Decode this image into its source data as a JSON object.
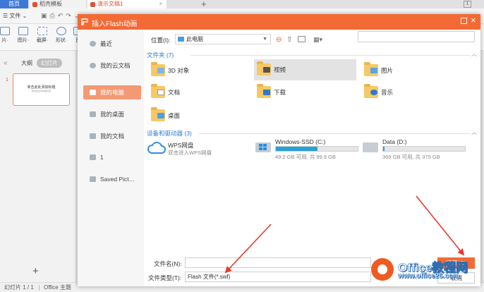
{
  "app": {
    "tabs": [
      {
        "label": "首页"
      },
      {
        "label": "稻壳模板"
      },
      {
        "label": "演示文稿1"
      }
    ],
    "menu_file": "文件",
    "toolbar": [
      {
        "label": "片·"
      },
      {
        "label": "图片·"
      },
      {
        "label": "截屏·"
      },
      {
        "label": "形状·"
      },
      {
        "label": "图"
      }
    ],
    "left_panel": {
      "tab_outline": "大纲",
      "tab_slides": "幻灯片",
      "slide_number": "1",
      "slide_title": "单击此处添加标题",
      "slide_subtitle": "单击此处添加副标题"
    },
    "status": {
      "slide_counter": "幻灯片 1 / 1",
      "theme": "Office 主题"
    }
  },
  "dialog": {
    "title": "插入Flash动画",
    "sidebar": [
      {
        "label": "最近"
      },
      {
        "label": "我的云文档"
      },
      {
        "label": "我的电脑"
      },
      {
        "label": "我的桌面"
      },
      {
        "label": "我的文档"
      },
      {
        "label": "1"
      },
      {
        "label": "Saved Pict…"
      }
    ],
    "location_label": "位置(I):",
    "location_value": "此电脑",
    "folders_section": "文件夹 (7)",
    "folders": [
      {
        "label": "3D 对象"
      },
      {
        "label": "视频"
      },
      {
        "label": "图片"
      },
      {
        "label": "文档"
      },
      {
        "label": "下载"
      },
      {
        "label": "音乐"
      },
      {
        "label": "桌面"
      }
    ],
    "devices_section": "设备和驱动器 (3)",
    "cloud": {
      "name": "WPS网盘",
      "sub": "双击进入WPS网盘"
    },
    "drives": [
      {
        "name": "Windows-SSD (C:)",
        "info": "49.2 GB 可用, 共 99.9 GB",
        "used_fraction": 0.51
      },
      {
        "name": "Data (D:)",
        "info": "369 GB 可用, 共 375 GB",
        "used_fraction": 0.02
      }
    ],
    "filename_label": "文件名(N):",
    "filename_value": "",
    "filetype_label": "文件类型(T):",
    "filetype_value": "Flash 文件(*.swf)",
    "open_button": "打开(O)",
    "cancel_button": "取消"
  },
  "watermark": {
    "brand": "Office教程网",
    "url": "www.office26.com"
  },
  "colors": {
    "accent": "#f36a35",
    "link_blue": "#2f79d1",
    "arrow_red": "#e8392f",
    "drive_fill": "#26a0da"
  }
}
